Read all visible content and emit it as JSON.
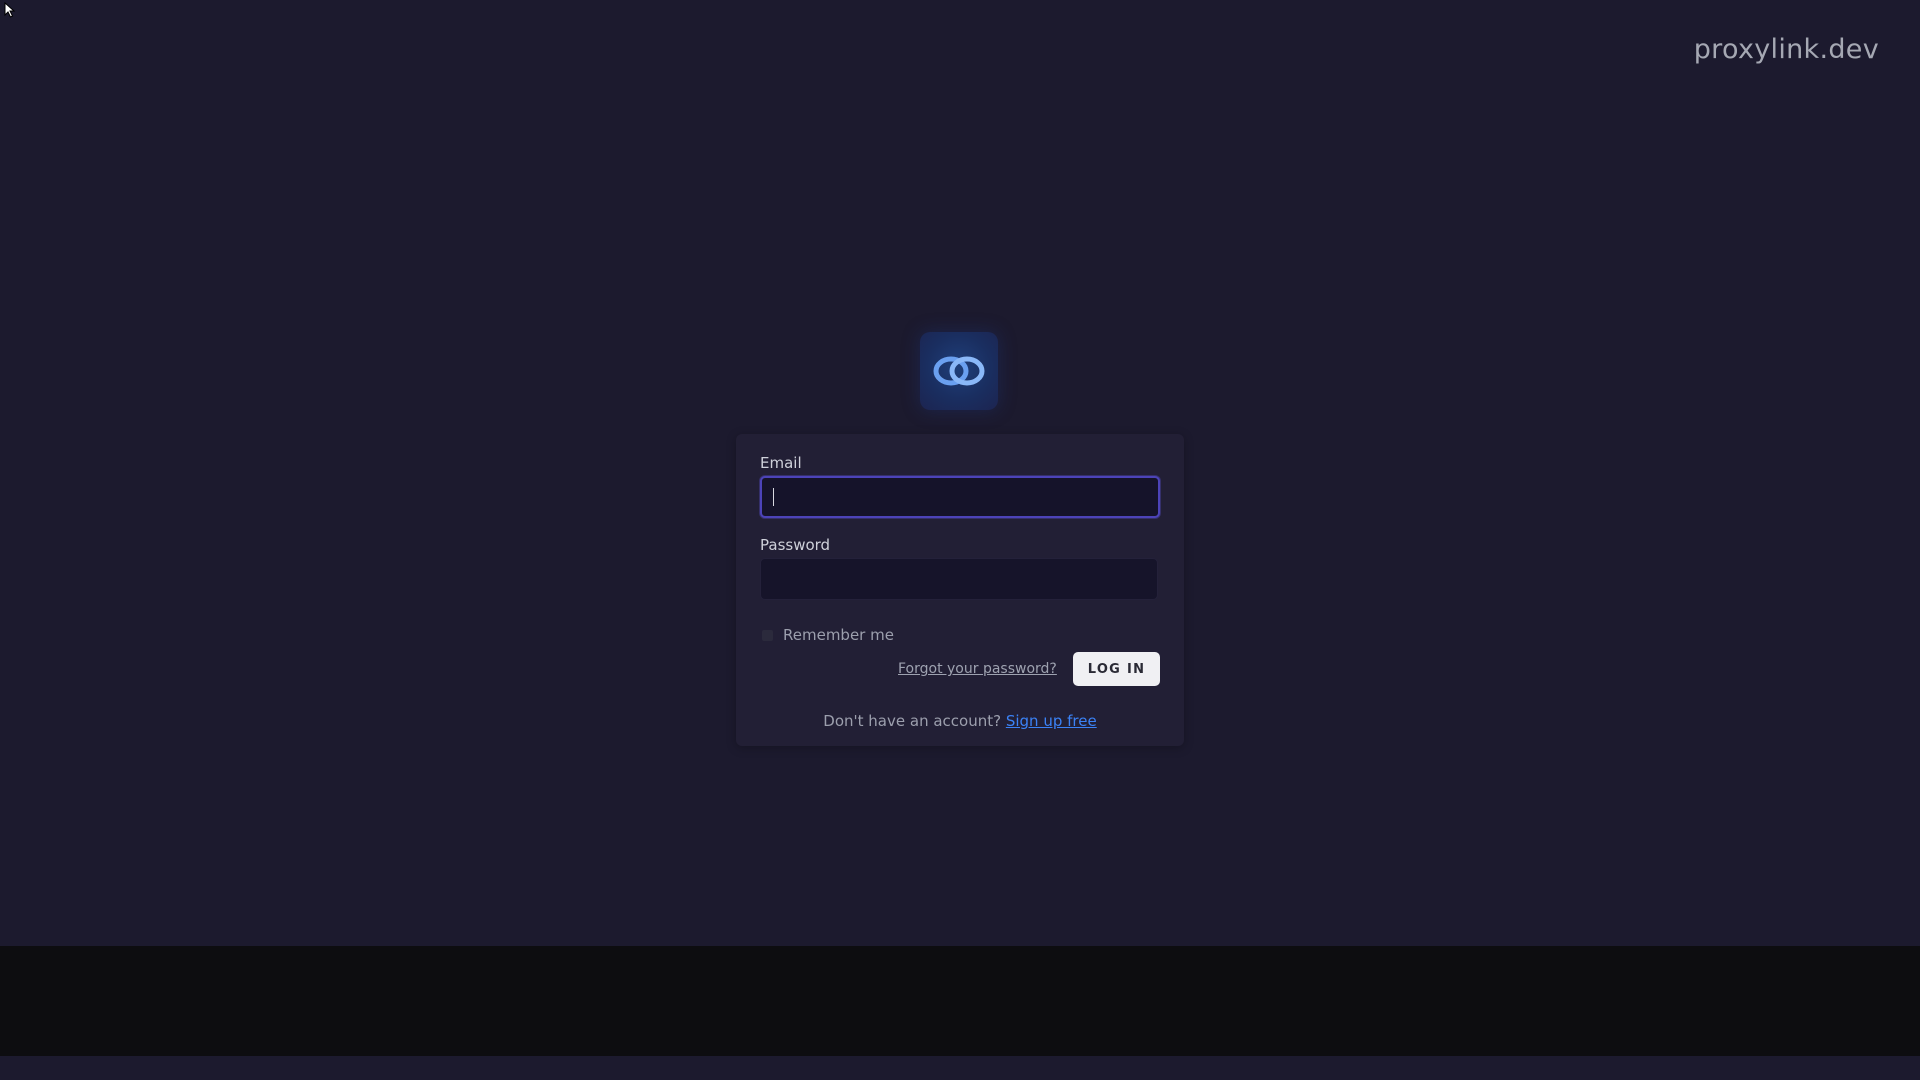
{
  "header": {
    "brand": "proxylink.dev"
  },
  "logo": {
    "icon": "interlocked-rings-icon",
    "accent": "#6aa0f0"
  },
  "form": {
    "email_label": "Email",
    "email_value": "",
    "password_label": "Password",
    "password_value": "",
    "remember_label": "Remember me",
    "remember_checked": false,
    "forgot_label": "Forgot your password?",
    "login_label": "LOG IN",
    "signup_prompt": "Don't have an account?",
    "signup_link": "Sign up free"
  },
  "colors": {
    "background": "#1c1a2e",
    "card": "#221f35",
    "focus_border": "#4c43b8",
    "link": "#3b82f6",
    "footer": "#0d0d10"
  }
}
